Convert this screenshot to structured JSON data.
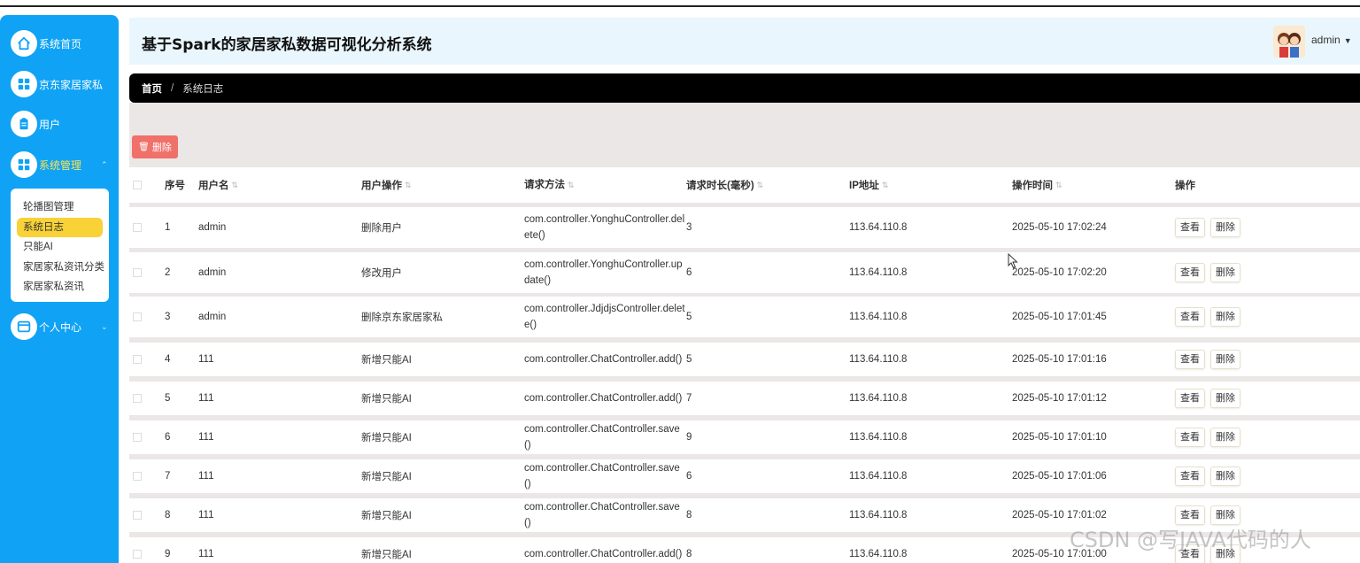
{
  "sidebar": {
    "items": [
      {
        "label": "系统首页",
        "icon": "home-icon"
      },
      {
        "label": "京东家居家私",
        "icon": "grid-icon"
      },
      {
        "label": "用户",
        "icon": "clipboard-icon"
      },
      {
        "label": "系统管理",
        "icon": "grid-icon"
      },
      {
        "label": "个人中心",
        "icon": "card-icon"
      }
    ],
    "submenu": [
      {
        "label": "轮播图管理"
      },
      {
        "label": "系统日志"
      },
      {
        "label": "只能AI"
      },
      {
        "label": "家居家私资讯分类"
      },
      {
        "label": "家居家私资讯"
      }
    ]
  },
  "header": {
    "title": "基于Spark的家居家私数据可视化分析系统",
    "user": "admin"
  },
  "breadcrumb": {
    "home": "首页",
    "separator": "/",
    "current": "系统日志"
  },
  "toolbar": {
    "delete_label": "删除",
    "delete_color": "#f0706a"
  },
  "table": {
    "headers": {
      "index": "序号",
      "username": "用户名",
      "operation": "用户操作",
      "method": "请求方法",
      "duration": "请求时长(毫秒)",
      "ip": "IP地址",
      "time": "操作时间",
      "actions": "操作"
    },
    "view_label": "查看",
    "delete_label": "删除",
    "rows": [
      {
        "index": "1",
        "username": "admin",
        "operation": "删除用户",
        "method": "com.controller.YonghuController.delete()",
        "duration": "3",
        "ip": "113.64.110.8",
        "time": "2025-05-10 17:02:24"
      },
      {
        "index": "2",
        "username": "admin",
        "operation": "修改用户",
        "method": "com.controller.YonghuController.update()",
        "duration": "6",
        "ip": "113.64.110.8",
        "time": "2025-05-10 17:02:20"
      },
      {
        "index": "3",
        "username": "admin",
        "operation": "删除京东家居家私",
        "method": "com.controller.JdjdjsController.delete()",
        "duration": "5",
        "ip": "113.64.110.8",
        "time": "2025-05-10 17:01:45"
      },
      {
        "index": "4",
        "username": "111",
        "operation": "新增只能AI",
        "method": "com.controller.ChatController.add()",
        "duration": "5",
        "ip": "113.64.110.8",
        "time": "2025-05-10 17:01:16"
      },
      {
        "index": "5",
        "username": "111",
        "operation": "新增只能AI",
        "method": "com.controller.ChatController.add()",
        "duration": "7",
        "ip": "113.64.110.8",
        "time": "2025-05-10 17:01:12"
      },
      {
        "index": "6",
        "username": "111",
        "operation": "新增只能AI",
        "method": "com.controller.ChatController.save()",
        "duration": "9",
        "ip": "113.64.110.8",
        "time": "2025-05-10 17:01:10"
      },
      {
        "index": "7",
        "username": "111",
        "operation": "新增只能AI",
        "method": "com.controller.ChatController.save()",
        "duration": "6",
        "ip": "113.64.110.8",
        "time": "2025-05-10 17:01:06"
      },
      {
        "index": "8",
        "username": "111",
        "operation": "新增只能AI",
        "method": "com.controller.ChatController.save()",
        "duration": "8",
        "ip": "113.64.110.8",
        "time": "2025-05-10 17:01:02"
      },
      {
        "index": "9",
        "username": "111",
        "operation": "新增只能AI",
        "method": "com.controller.ChatController.add()",
        "duration": "8",
        "ip": "113.64.110.8",
        "time": "2025-05-10 17:01:00"
      }
    ]
  },
  "watermark": "CSDN @写JAVA代码的人",
  "colors": {
    "sidebar": "#10a3f5",
    "active_submenu": "#f8d236",
    "header_bg": "#e9f6fd",
    "content_bg": "#ebe7e6"
  }
}
